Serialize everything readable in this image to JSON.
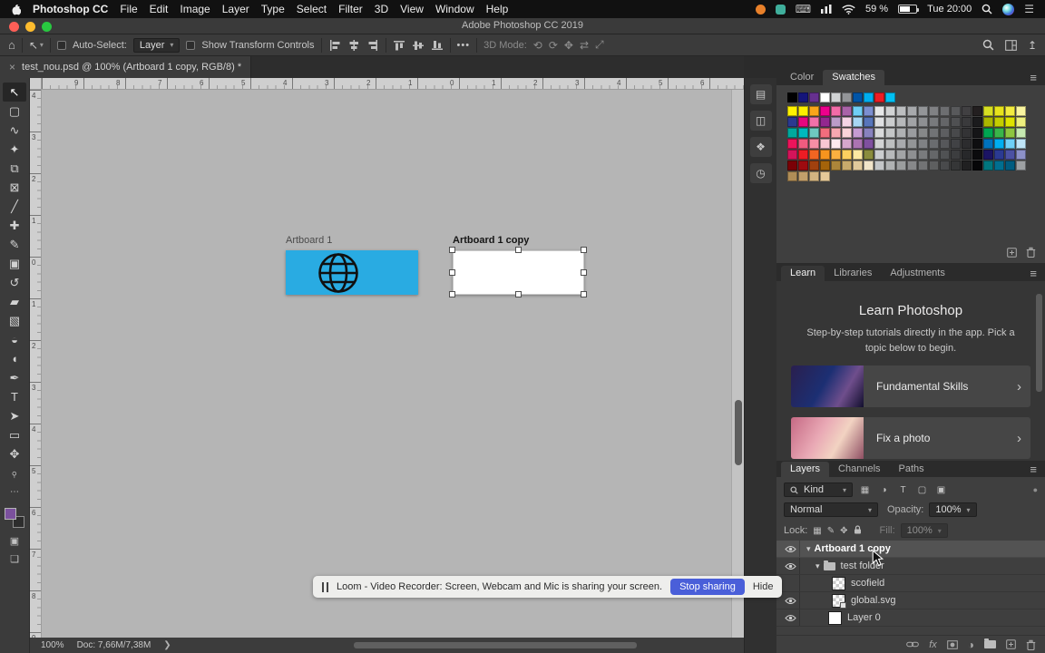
{
  "colors": {
    "artboard_blue": "#29abe2",
    "loom_button_blue": "#4a5fd9",
    "foreground_color": "#7b519d",
    "background_color": "#2d2d2d"
  },
  "menu_bar": {
    "app_name": "Photoshop CC",
    "items": [
      "File",
      "Edit",
      "Image",
      "Layer",
      "Type",
      "Select",
      "Filter",
      "3D",
      "View",
      "Window",
      "Help"
    ],
    "battery": "59 %",
    "time": "Tue 20:00"
  },
  "window": {
    "title": "Adobe Photoshop CC 2019"
  },
  "options_bar": {
    "auto_select_label": "Auto-Select:",
    "auto_select_value": "Layer",
    "show_transform_label": "Show Transform Controls",
    "mode_3d_label": "3D Mode:"
  },
  "document_tab": {
    "close": "×",
    "title": "test_nou.psd @ 100% (Artboard 1 copy, RGB/8) *"
  },
  "tools": [
    {
      "name": "move-tool",
      "glyph": "↖",
      "selected": true
    },
    {
      "name": "marquee-tool",
      "glyph": "▢"
    },
    {
      "name": "lasso-tool",
      "glyph": "∿"
    },
    {
      "name": "quick-selection-tool",
      "glyph": "✦"
    },
    {
      "name": "crop-tool",
      "glyph": "⧉"
    },
    {
      "name": "frame-tool",
      "glyph": "⊠"
    },
    {
      "name": "eyedropper-tool",
      "glyph": "╱"
    },
    {
      "name": "healing-brush-tool",
      "glyph": "✚"
    },
    {
      "name": "brush-tool",
      "glyph": "✎"
    },
    {
      "name": "clone-stamp-tool",
      "glyph": "▣"
    },
    {
      "name": "history-brush-tool",
      "glyph": "↺"
    },
    {
      "name": "eraser-tool",
      "glyph": "▰"
    },
    {
      "name": "gradient-tool",
      "glyph": "▧"
    },
    {
      "name": "blur-tool",
      "glyph": "◒"
    },
    {
      "name": "dodge-tool",
      "glyph": "◖"
    },
    {
      "name": "pen-tool",
      "glyph": "✒"
    },
    {
      "name": "type-tool",
      "glyph": "T"
    },
    {
      "name": "path-selection-tool",
      "glyph": "➤"
    },
    {
      "name": "shape-tool",
      "glyph": "▭"
    },
    {
      "name": "hand-tool",
      "glyph": "✥"
    },
    {
      "name": "zoom-tool",
      "glyph": "⌕",
      "rotate": true
    }
  ],
  "dock_icons": [
    {
      "name": "collapsed-panel-history-icon",
      "glyph": "▤"
    },
    {
      "name": "collapsed-panel-properties-icon",
      "glyph": "◫"
    },
    {
      "name": "collapsed-panel-actions-icon",
      "glyph": "❖"
    },
    {
      "name": "collapsed-panel-clock-icon",
      "glyph": "◷"
    }
  ],
  "canvas": {
    "ruler_top": [
      "9",
      "8",
      "7",
      "6",
      "5",
      "4",
      "3",
      "2",
      "1",
      "0",
      "1",
      "2",
      "3",
      "4",
      "5",
      "6"
    ],
    "ruler_left": [
      "4",
      "3",
      "2",
      "1",
      "0",
      "1",
      "2",
      "3",
      "4",
      "5",
      "6",
      "7",
      "8",
      "9"
    ],
    "artboards": [
      {
        "label": "Artboard 1",
        "fill": "#29abe2"
      },
      {
        "label": "Artboard 1 copy",
        "fill": "#ffffff",
        "selected": true
      }
    ]
  },
  "status_bar": {
    "zoom": "100%",
    "doc_info": "Doc: 7,66M/7,38M",
    "chevron": "❯"
  },
  "loom_bar": {
    "message": "Loom - Video Recorder: Screen, Webcam and Mic is sharing your screen.",
    "stop_button": "Stop sharing",
    "hide_button": "Hide"
  },
  "swatches_panel": {
    "tabs": [
      "Color",
      "Swatches"
    ],
    "active_tab": "Swatches",
    "top_row": [
      "#000000",
      "#15157a",
      "#66308f",
      "#ffffff",
      "#d1d3d4",
      "#939598",
      "#0054a6",
      "#00aeef",
      "#ed1c24",
      "#00c0f3"
    ],
    "rows": [
      [
        "#fff200",
        "#fdee00",
        "#f9a61a",
        "#ec008c",
        "#f26ca8",
        "#a963a8",
        "#6fcef5",
        "#7c8fd0",
        "#e6e7e8",
        "#d1d3d4",
        "#bcbec0",
        "#a7a9ac",
        "#939598",
        "#808184",
        "#6d6e71",
        "#58595b",
        "#414042",
        "#231f20",
        "#d7df23",
        "#e7e31c",
        "#f3ec40",
        "#faf5a0"
      ],
      [
        "#2b3990",
        "#e6067f",
        "#f171a9",
        "#93278f",
        "#bb9cc8",
        "#f5d4e5",
        "#a7d6f3",
        "#5775ba",
        "#dfe0e2",
        "#cbcdce",
        "#b6b8ba",
        "#a1a3a6",
        "#8d8f92",
        "#787a7d",
        "#646568",
        "#4f5052",
        "#3a3a3c",
        "#1b1b1d",
        "#aab600",
        "#c4cd00",
        "#dfe300",
        "#eef07e"
      ],
      [
        "#00a99d",
        "#00b9bd",
        "#6ec9c0",
        "#f26d7d",
        "#f8a8b1",
        "#fbd3d9",
        "#c59bd2",
        "#8882be",
        "#d9dadb",
        "#c4c6c7",
        "#afb1b3",
        "#9a9c9f",
        "#868889",
        "#717376",
        "#5d5e61",
        "#48494b",
        "#333335",
        "#151517",
        "#00a651",
        "#3ab54a",
        "#8ec63f",
        "#c6e9b1"
      ],
      [
        "#ed145b",
        "#f05b7f",
        "#f68ea5",
        "#f9c6d2",
        "#fde9ef",
        "#d6a7cc",
        "#ab73b1",
        "#7f509f",
        "#d2d3d4",
        "#bdbfc0",
        "#a8aaad",
        "#939597",
        "#7f8184",
        "#6a6c6f",
        "#56575a",
        "#414245",
        "#2c2c2e",
        "#0e0e10",
        "#0072bc",
        "#00aef0",
        "#6ed0f7",
        "#bfe5f8"
      ],
      [
        "#d4145a",
        "#ed1c24",
        "#f26522",
        "#f7941e",
        "#fbb040",
        "#fcd05f",
        "#fde9a2",
        "#8a8c3d",
        "#cbcdcf",
        "#b7b9bb",
        "#a2a4a6",
        "#8e9092",
        "#797b7d",
        "#656769",
        "#505254",
        "#3c3d3f",
        "#27282a",
        "#0b0b0d",
        "#1b1464",
        "#2b3a92",
        "#4b51a3",
        "#8c91c8"
      ],
      [
        "#7a0006",
        "#9e0b0f",
        "#a1410e",
        "#a4630a",
        "#ab853a",
        "#c8aa6c",
        "#e1c99b",
        "#f1e4c9",
        "#c4c6c8",
        "#b0b2b3",
        "#9b9d9e",
        "#87888a",
        "#727375",
        "#5e5f60",
        "#494a4c",
        "#353637",
        "#202021",
        "#060608",
        "#00767e",
        "#006f90",
        "#005c80",
        "#9da0a3"
      ]
    ],
    "partial_row": [
      "#b08d57",
      "#c29f6b",
      "#d3b481",
      "#e5c998"
    ]
  },
  "learn_panel": {
    "tabs": [
      "Learn",
      "Libraries",
      "Adjustments"
    ],
    "active_tab": "Learn",
    "title": "Learn Photoshop",
    "subtitle": "Step-by-step tutorials directly in the app. Pick a topic below to begin.",
    "cards": [
      {
        "label": "Fundamental Skills"
      },
      {
        "label": "Fix a photo"
      }
    ]
  },
  "layers_panel": {
    "tabs": [
      "Layers",
      "Channels",
      "Paths"
    ],
    "active_tab": "Layers",
    "kind_label": "Kind",
    "blend_mode": "Normal",
    "opacity_label": "Opacity:",
    "opacity_value": "100%",
    "lock_label": "Lock:",
    "fill_label": "Fill:",
    "fill_value": "100%",
    "fx_label": "fx",
    "layers": [
      {
        "name": "Artboard 1 copy",
        "kind": "artboard",
        "visible": true,
        "selected": true,
        "expanded": true
      },
      {
        "name": "test folder",
        "kind": "group",
        "visible": true,
        "expanded": true
      },
      {
        "name": "scofield",
        "kind": "pixel",
        "visible": false
      },
      {
        "name": "global.svg",
        "kind": "vector",
        "visible": true
      },
      {
        "name": "Layer 0",
        "kind": "white",
        "visible": true
      }
    ]
  }
}
